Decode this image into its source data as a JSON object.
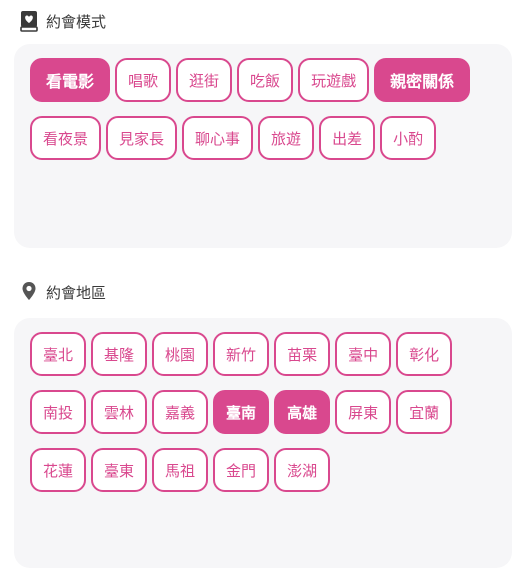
{
  "mode_section": {
    "title": "約會模式",
    "icon": "heart-book-icon",
    "options": [
      {
        "label": "看電影",
        "selected": true
      },
      {
        "label": "唱歌",
        "selected": false
      },
      {
        "label": "逛街",
        "selected": false
      },
      {
        "label": "吃飯",
        "selected": false
      },
      {
        "label": "玩遊戲",
        "selected": false
      },
      {
        "label": "親密關係",
        "selected": true
      },
      {
        "label": "看夜景",
        "selected": false
      },
      {
        "label": "見家長",
        "selected": false
      },
      {
        "label": "聊心事",
        "selected": false
      },
      {
        "label": "旅遊",
        "selected": false
      },
      {
        "label": "出差",
        "selected": false
      },
      {
        "label": "小酌",
        "selected": false
      }
    ]
  },
  "area_section": {
    "title": "約會地區",
    "icon": "location-pin-icon",
    "options": [
      {
        "label": "臺北",
        "selected": false
      },
      {
        "label": "基隆",
        "selected": false
      },
      {
        "label": "桃園",
        "selected": false
      },
      {
        "label": "新竹",
        "selected": false
      },
      {
        "label": "苗栗",
        "selected": false
      },
      {
        "label": "臺中",
        "selected": false
      },
      {
        "label": "彰化",
        "selected": false
      },
      {
        "label": "南投",
        "selected": false
      },
      {
        "label": "雲林",
        "selected": false
      },
      {
        "label": "嘉義",
        "selected": false
      },
      {
        "label": "臺南",
        "selected": true
      },
      {
        "label": "高雄",
        "selected": true
      },
      {
        "label": "屏東",
        "selected": false
      },
      {
        "label": "宜蘭",
        "selected": false
      },
      {
        "label": "花蓮",
        "selected": false
      },
      {
        "label": "臺東",
        "selected": false
      },
      {
        "label": "馬祖",
        "selected": false
      },
      {
        "label": "金門",
        "selected": false
      },
      {
        "label": "澎湖",
        "selected": false
      }
    ]
  },
  "colors": {
    "accent": "#d9488e",
    "panel_bg": "#f6f6f8",
    "icon": "#444444"
  }
}
